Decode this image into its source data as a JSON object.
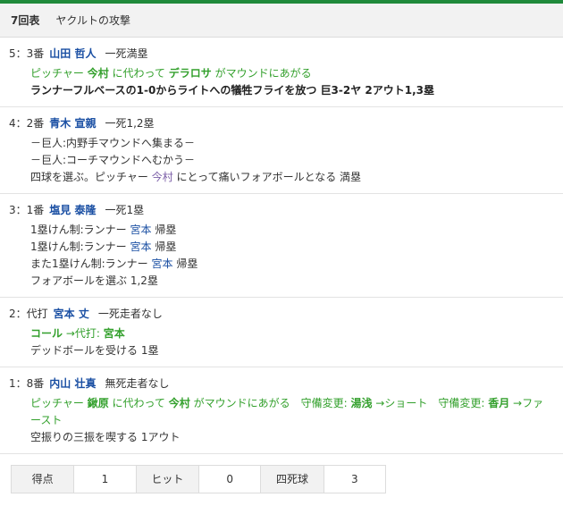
{
  "header": {
    "inning": "7回表",
    "team_attack": "ヤクルトの攻撃"
  },
  "events": [
    {
      "head": {
        "index": "5：3番",
        "player": "山田 哲人",
        "result": "一死満塁"
      },
      "lines": [
        {
          "type": "green",
          "parts": [
            {
              "t": "ピッチャー ",
              "b": false
            },
            {
              "t": "今村",
              "b": true
            },
            {
              "t": " に代わって ",
              "b": false
            },
            {
              "t": "デラロサ",
              "b": true
            },
            {
              "t": " がマウンドにあがる",
              "b": false
            }
          ]
        },
        {
          "type": "bold",
          "text": "ランナーフルベースの1-0からライトへの犠牲フライを放つ 巨3-2ヤ 2アウト1,3塁"
        }
      ]
    },
    {
      "head": {
        "index": "4：2番",
        "player": "青木 宣親",
        "result": "一死1,2塁"
      },
      "lines": [
        {
          "type": "plain",
          "text": "－巨人:内野手マウンドへ集まる－"
        },
        {
          "type": "plain",
          "text": "－巨人:コーチマウンドへむかう－"
        },
        {
          "type": "mixed",
          "before": "四球を選ぶ。ピッチャー ",
          "highlight": "今村",
          "after": " にとって痛いフォアボールとなる 満塁"
        }
      ]
    },
    {
      "head": {
        "index": "3：1番",
        "player": "塩見 泰隆",
        "result": "一死1塁"
      },
      "lines": [
        {
          "type": "blue",
          "before": "1塁けん制:ランナー ",
          "highlight": "宮本",
          "after": " 帰塁"
        },
        {
          "type": "blue",
          "before": "1塁けん制:ランナー ",
          "highlight": "宮本",
          "after": " 帰塁"
        },
        {
          "type": "blue",
          "before": "また1塁けん制:ランナー ",
          "highlight": "宮本",
          "after": " 帰塁"
        },
        {
          "type": "plain",
          "text": "フォアボールを選ぶ 1,2塁"
        }
      ]
    },
    {
      "head": {
        "index": "2：代打",
        "player": "宮本 丈",
        "result": "一死走者なし"
      },
      "lines": [
        {
          "type": "green",
          "parts": [
            {
              "t": "コール",
              "b": true
            },
            {
              "t": " →代打: ",
              "b": false
            },
            {
              "t": "宮本",
              "b": true
            }
          ]
        },
        {
          "type": "plain",
          "text": "デッドボールを受ける 1塁"
        }
      ]
    },
    {
      "head": {
        "index": "1：8番",
        "player": "内山 壮真",
        "result": "無死走者なし"
      },
      "lines": [
        {
          "type": "green",
          "parts": [
            {
              "t": "ピッチャー ",
              "b": false
            },
            {
              "t": "鍬原",
              "b": true
            },
            {
              "t": " に代わって ",
              "b": false
            },
            {
              "t": "今村",
              "b": true
            },
            {
              "t": " がマウンドにあがる　守備変更: ",
              "b": false
            },
            {
              "t": "湯浅",
              "b": true
            },
            {
              "t": " →ショート　守備変更: ",
              "b": false
            },
            {
              "t": "香月",
              "b": true
            },
            {
              "t": " →ファースト",
              "b": false
            }
          ]
        },
        {
          "type": "plain",
          "text": "空振りの三振を喫する 1アウト"
        }
      ]
    }
  ],
  "stats": [
    {
      "label": "得点",
      "value": "1"
    },
    {
      "label": "ヒット",
      "value": "0"
    },
    {
      "label": "四死球",
      "value": "3"
    }
  ],
  "colors": {
    "accent": "#1f8a3b",
    "player": "#1a4fa3",
    "green_text": "#33a02c",
    "pitcher_ref": "#7b5ea7"
  }
}
